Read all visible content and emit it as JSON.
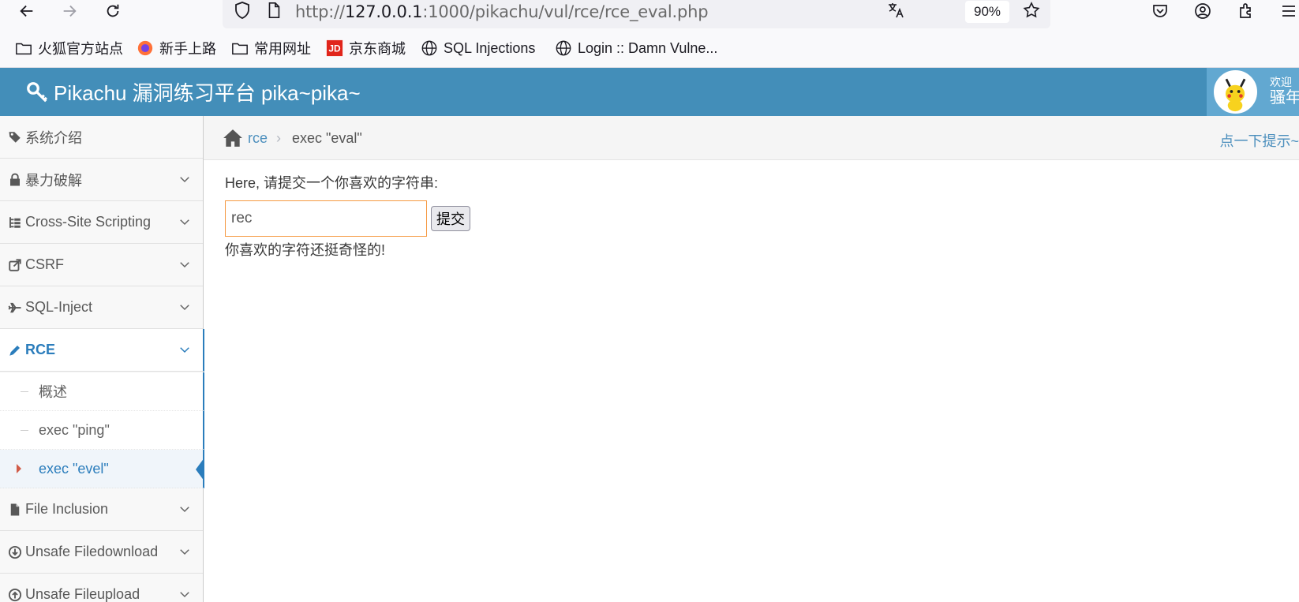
{
  "browser": {
    "url_prefix": "http://",
    "url_host": "127.0.0.1",
    "url_rest": ":1000/pikachu/vul/rce/rce_eval.php",
    "zoom": "90%",
    "bookmarks": [
      "火狐官方站点",
      "新手上路",
      "常用网址",
      "京东商城",
      "SQL Injections",
      "Login :: Damn Vulne..."
    ]
  },
  "app": {
    "title": "Pikachu 漏洞练习平台 pika~pika~",
    "welcome": "欢迎",
    "username": "骚年",
    "header_color": "#438eb9"
  },
  "sidebar": {
    "items": [
      {
        "label": "系统介绍",
        "icon": "tags-icon"
      },
      {
        "label": "暴力破解",
        "icon": "lock-icon"
      },
      {
        "label": "Cross-Site Scripting",
        "icon": "sitemap-icon"
      },
      {
        "label": "CSRF",
        "icon": "share-square-icon"
      },
      {
        "label": "SQL-Inject",
        "icon": "plane-icon"
      },
      {
        "label": "RCE",
        "icon": "pencil-icon"
      },
      {
        "label": "File Inclusion",
        "icon": "file-icon"
      },
      {
        "label": "Unsafe Filedownload",
        "icon": "download-circle-icon"
      },
      {
        "label": "Unsafe Fileupload",
        "icon": "upload-circle-icon"
      }
    ],
    "rce_sub": [
      "概述",
      "exec \"ping\"",
      "exec \"evel\""
    ]
  },
  "breadcrumb": {
    "link": "rce",
    "current": "exec \"eval\"",
    "hint": "点一下提示~"
  },
  "main": {
    "prompt": "Here, 请提交一个你喜欢的字符串:",
    "input_value": "rec",
    "submit_label": "提交",
    "result": "你喜欢的字符还挺奇怪的!"
  }
}
